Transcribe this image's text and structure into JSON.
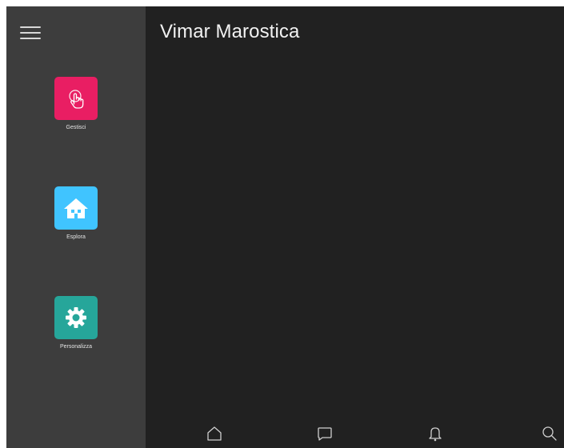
{
  "header": {
    "title": "Vimar Marostica"
  },
  "sidebar": {
    "menu_icon": "hamburger-icon",
    "items": [
      {
        "label": "Gestisci",
        "icon": "touch-hand-icon",
        "color": "#e91e63"
      },
      {
        "label": "Esplora",
        "icon": "house-icon",
        "color": "#40c4ff"
      },
      {
        "label": "Personalizza",
        "icon": "gear-icon",
        "color": "#26a69a"
      }
    ]
  },
  "bottom_nav": [
    {
      "icon": "home-icon"
    },
    {
      "icon": "chat-icon"
    },
    {
      "icon": "bell-icon"
    },
    {
      "icon": "search-icon"
    }
  ],
  "colors": {
    "background": "#212121",
    "sidebar": "#3d3d3d",
    "text": "#f2f2f2"
  }
}
